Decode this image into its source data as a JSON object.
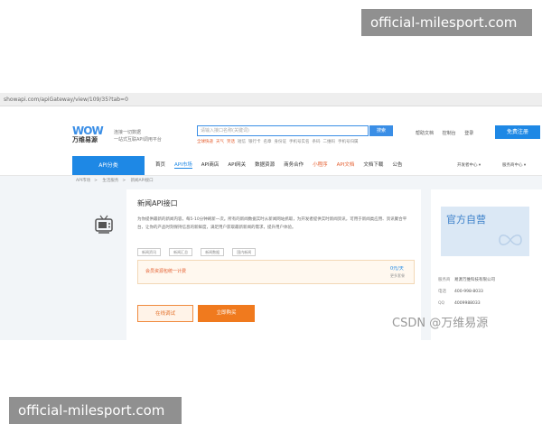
{
  "watermark_top": "official-milesport.com",
  "watermark_bottom": "official-milesport.com",
  "address_bar": "showapi.com/apiGateway/view/109/35?tab=0",
  "logo": {
    "mark": "WOW",
    "name": "万维易源"
  },
  "slogan": [
    "连接一切数据",
    "一站式互联API调用平台"
  ],
  "search": {
    "placeholder": "请输入接口名称(关键词)",
    "button": "搜索"
  },
  "hot_words": [
    {
      "text": "全球快递",
      "color": "red"
    },
    {
      "text": "天气",
      "color": "red"
    },
    {
      "text": "笑话",
      "color": "red"
    },
    {
      "text": "短信",
      "color": "gray"
    },
    {
      "text": "银行卡",
      "color": "gray"
    },
    {
      "text": "名章",
      "color": "gray"
    },
    {
      "text": "身份证",
      "color": "gray"
    },
    {
      "text": "手机号实名",
      "color": "gray"
    },
    {
      "text": "条码",
      "color": "gray"
    },
    {
      "text": "二维码",
      "color": "gray"
    },
    {
      "text": "手机号归属",
      "color": "gray"
    }
  ],
  "top_links": [
    "帮助文档",
    "控制台",
    "登录"
  ],
  "register_button": "免费注册",
  "nav": {
    "category": "API分类",
    "items": [
      {
        "label": "首页",
        "style": "normal"
      },
      {
        "label": "API市场",
        "style": "active"
      },
      {
        "label": "API商店",
        "style": "normal"
      },
      {
        "label": "API网关",
        "style": "normal"
      },
      {
        "label": "数据资源",
        "style": "normal"
      },
      {
        "label": "商务合作",
        "style": "normal"
      },
      {
        "label": "小程序",
        "style": "highlight"
      },
      {
        "label": "API文档",
        "style": "highlight"
      },
      {
        "label": "文档下载",
        "style": "normal"
      },
      {
        "label": "公告",
        "style": "normal"
      }
    ],
    "selectors": [
      "开发者中心",
      "服务商中心"
    ]
  },
  "breadcrumb": [
    "API市场",
    "生活服务",
    "新闻API接口"
  ],
  "api": {
    "title": "新闻API接口",
    "description": "为你提供最新的新闻内容，每5-10分钟刷新一次。所有的新闻数据实时从新闻网站抓取，为开发者提供实时新闻资讯，可用于新闻类应用、资讯聚合平台，让你的产品时刻保持信息的新鲜度，满足用户获取最新新闻的需求，提升用户体验。",
    "tags": [
      "新闻资讯",
      "新闻汇总",
      "新闻数据",
      "国内新闻"
    ]
  },
  "plan": {
    "text": "会员资源包统一计费",
    "price": "0元/天",
    "sub": "更多套餐"
  },
  "buttons": {
    "try": "在线调试",
    "buy": "立即购买"
  },
  "side": {
    "banner_title": "官方自营",
    "info": [
      {
        "label": "服务商",
        "value": "易源万维科技有限公司"
      },
      {
        "label": "电话",
        "value": "400-998-8033"
      },
      {
        "label": "QQ",
        "value": "4009988033"
      }
    ]
  },
  "csdn_watermark": "CSDN @万维易源"
}
